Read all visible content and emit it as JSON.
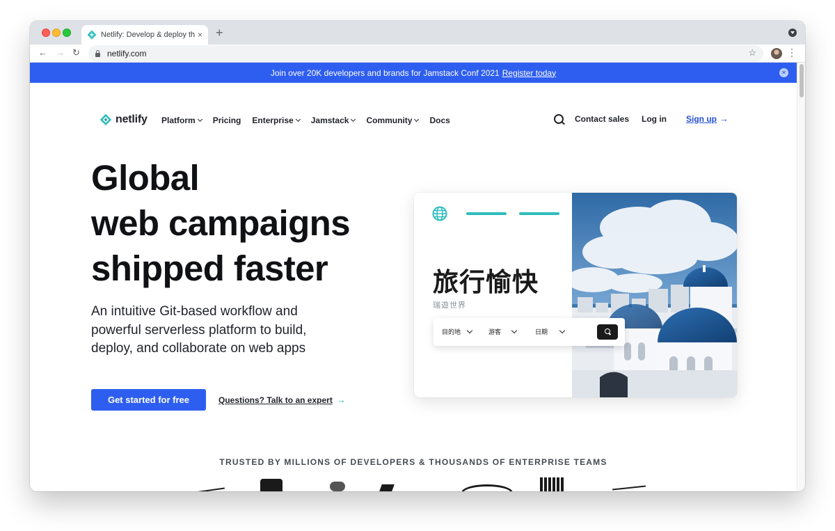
{
  "browser": {
    "tab_title": "Netlify: Develop & deploy the b…",
    "url": "netlify.com",
    "new_tab": "+",
    "close": "×",
    "back": "←",
    "forward": "→",
    "reload": "↻",
    "star": "☆",
    "menu": "⋮"
  },
  "banner": {
    "text": "Join over 20K developers and brands for Jamstack Conf 2021",
    "link": "Register today",
    "close": "×",
    "color": "#2e5ef0"
  },
  "nav": {
    "logo": "netlify",
    "items": [
      {
        "label": "Platform",
        "dropdown": true
      },
      {
        "label": "Pricing",
        "dropdown": false
      },
      {
        "label": "Enterprise",
        "dropdown": true
      },
      {
        "label": "Jamstack",
        "dropdown": true
      },
      {
        "label": "Community",
        "dropdown": true
      },
      {
        "label": "Docs",
        "dropdown": false
      }
    ],
    "contact": "Contact sales",
    "login": "Log in",
    "signup": "Sign up",
    "arrow": "→"
  },
  "hero": {
    "title_lines": [
      "Global",
      "web campaigns",
      "shipped faster"
    ],
    "subtitle": "An intuitive Git-based workflow and powerful serverless platform to build, deploy, and collaborate on web apps",
    "cta_primary": "Get started for free",
    "cta_secondary": "Questions? Talk to an expert",
    "cta_arrow": "→"
  },
  "card": {
    "title": "旅行愉快",
    "subtitle": "瑞遊世界",
    "fields": [
      "目的地",
      "游客",
      "日期"
    ],
    "accent": "#2fbdbd"
  },
  "trusted": {
    "label": "TRUSTED BY MILLIONS OF DEVELOPERS & THOUSANDS OF ENTERPRISE TEAMS"
  }
}
